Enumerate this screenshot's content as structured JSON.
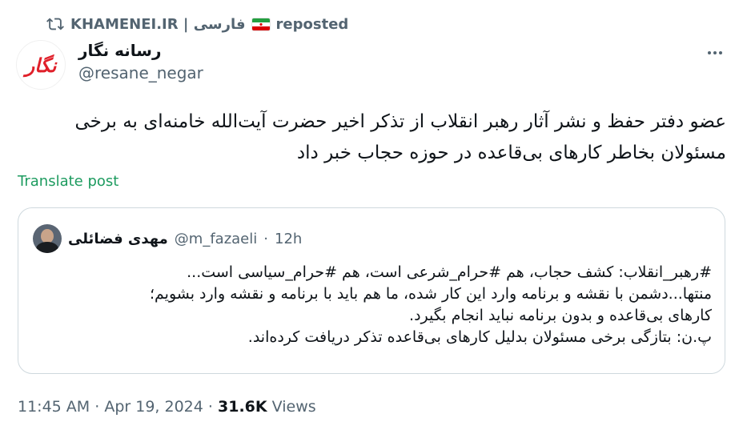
{
  "repost": {
    "account": "KHAMENEI.IR | فارسی",
    "label": "reposted"
  },
  "author": {
    "display_name": "رسانه نگار",
    "handle": "@resane_negar",
    "avatar_text": "نگار"
  },
  "tweet": {
    "text": "عضو دفتر حفظ و نشر آثار رهبر انقلاب از تذکر اخیر حضرت آیت‌الله خامنه‌ای به برخی مسئولان بخاطر کارهای بی‌قاعده در حوزه حجاب خبر داد",
    "translate_label": "Translate post"
  },
  "quote": {
    "name": "مهدی فضائلی",
    "handle": "@m_fazaeli",
    "separator": "·",
    "time": "12h",
    "lines": [
      "#رهبر_انقلاب: کشف حجاب، هم #حرام_شرعی است، هم #حرام_سیاسی است...",
      "منتها...دشمن با نقشه و برنامه وارد این کار شده، ما هم باید با برنامه و نقشه وارد بشویم؛",
      "کارهای بی‌قاعده و بدون برنامه نباید انجام بگیرد.",
      "پ.ن: بتازگی برخی مسئولان بدلیل کارهای بی‌قاعده تذکر دریافت کرده‌اند."
    ]
  },
  "footer": {
    "time": "11:45 AM",
    "sep1": "·",
    "date": "Apr 19, 2024",
    "sep2": "·",
    "views_count": "31.6K",
    "views_label": "Views"
  },
  "icons": {
    "repost": "repost-icon",
    "flag": "iran-flag-icon",
    "more": "more-icon"
  },
  "colors": {
    "accent_link": "#1d9b5f",
    "secondary_text": "#536471",
    "border": "#cfd9de"
  }
}
